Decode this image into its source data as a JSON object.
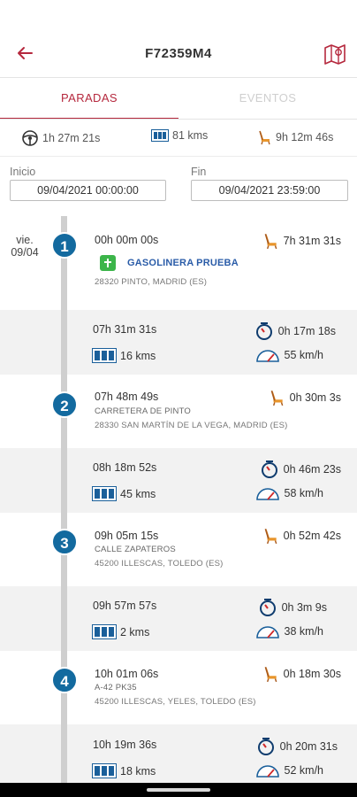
{
  "header": {
    "title": "F72359M4",
    "back_icon": "back-arrow-icon",
    "map_icon": "map-icon"
  },
  "colors": {
    "accent": "#b5283d",
    "stop_badge": "#136a9f",
    "poi_green": "#3cb54a",
    "poi_text": "#2a5ca8"
  },
  "tabs": [
    {
      "label": "PARADAS",
      "active": true
    },
    {
      "label": "EVENTOS",
      "active": false
    }
  ],
  "summary": {
    "driving_time": "1h 27m 21s",
    "distance": "81 kms",
    "stopped_time": "9h 12m 46s"
  },
  "filter": {
    "start_label": "Inicio",
    "start_value": "09/04/2021 00:00:00",
    "end_label": "Fin",
    "end_value": "09/04/2021 23:59:00"
  },
  "day": {
    "weekday": "vie.",
    "date": "09/04"
  },
  "stops": [
    {
      "number": "1",
      "arrival": "00h 00m 00s",
      "duration": "7h 31m 31s",
      "poi": "GASOLINERA PRUEBA",
      "address": "28320 PINTO, MADRID (ES)"
    },
    {
      "number": "2",
      "arrival": "07h 48m 49s",
      "duration": "0h 30m 3s",
      "street": "CARRETERA DE PINTO",
      "address": "28330 SAN MARTÍN DE LA VEGA, MADRID (ES)"
    },
    {
      "number": "3",
      "arrival": "09h 05m 15s",
      "duration": "0h 52m 42s",
      "street": "CALLE ZAPATEROS",
      "address": "45200 ILLESCAS, TOLEDO (ES)"
    },
    {
      "number": "4",
      "arrival": "10h 01m 06s",
      "duration": "0h 18m 30s",
      "street": "A-42 PK35",
      "address": "45200 ILLESCAS, YELES, TOLEDO (ES)"
    }
  ],
  "segments": [
    {
      "departure": "07h 31m 31s",
      "drive_time": "0h 17m 18s",
      "distance": "16 kms",
      "speed": "55 km/h"
    },
    {
      "departure": "08h 18m 52s",
      "drive_time": "0h 46m 23s",
      "distance": "45 kms",
      "speed": "58 km/h"
    },
    {
      "departure": "09h 57m 57s",
      "drive_time": "0h 3m 9s",
      "distance": "2 kms",
      "speed": "38 km/h"
    },
    {
      "departure": "10h 19m 36s",
      "drive_time": "0h 20m 31s",
      "distance": "18 kms",
      "speed": "52 km/h"
    }
  ]
}
